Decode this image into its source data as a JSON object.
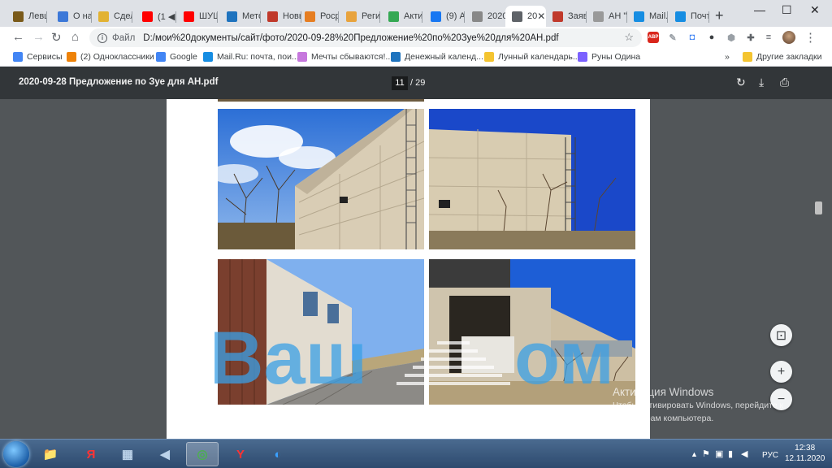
{
  "tabs": [
    {
      "label": "Левш",
      "icon": "book-icon",
      "color": "#7a5a1a"
    },
    {
      "label": "О на",
      "icon": "globe-blue-icon",
      "color": "#3c78d8"
    },
    {
      "label": "Сдел",
      "icon": "b-icon",
      "color": "#e2b233"
    },
    {
      "label": "(1 ◀",
      "icon": "youtube-icon",
      "color": "#ff0000"
    },
    {
      "label": "ШУШ",
      "icon": "youtube-icon",
      "color": "#ff0000"
    },
    {
      "label": "Мето",
      "icon": "metro-icon",
      "color": "#1e73be"
    },
    {
      "label": "Новь",
      "icon": "news-icon",
      "color": "#c0392b"
    },
    {
      "label": "Росре",
      "icon": "rosreestr-icon",
      "color": "#e67e22"
    },
    {
      "label": "Реги",
      "icon": "reg-icon",
      "color": "#e8a33d"
    },
    {
      "label": "Акти",
      "icon": "play-icon",
      "color": "#34a853"
    },
    {
      "label": "(9) А",
      "icon": "facebook-icon",
      "color": "#1877f2"
    },
    {
      "label": "2020",
      "icon": "globe-gray-icon",
      "color": "#888888"
    },
    {
      "label": "20",
      "icon": "globe-icon",
      "color": "#5f6368",
      "active": true
    },
    {
      "label": "Заяв",
      "icon": "flag-icon",
      "color": "#c0392b"
    },
    {
      "label": "АН \"",
      "icon": "triangle-icon",
      "color": "#999999"
    },
    {
      "label": "Mail.",
      "icon": "mail-at-icon",
      "color": "#168de2"
    },
    {
      "label": "Почт",
      "icon": "envelope-icon",
      "color": "#168de2"
    }
  ],
  "new_tab": "+",
  "window_controls": {
    "minimize": "—",
    "maximize": "☐",
    "close": "✕"
  },
  "toolbar": {
    "back": "←",
    "forward": "→",
    "reload": "↻",
    "home": "⌂",
    "scheme": "Файл",
    "url": "D:/мои%20документы/сайт/фото/2020-09-28%20Предложение%20по%20Зуе%20для%20АН.pdf",
    "star": "☆",
    "extensions": [
      {
        "label": "ABP",
        "color": "#d9261c"
      },
      {
        "label": "✎",
        "color": "#9aa0a6"
      },
      {
        "label": "◘",
        "color": "#4285f4"
      },
      {
        "label": "●",
        "color": "#3c4043"
      },
      {
        "label": "⬢",
        "color": "#9aa0a6"
      },
      {
        "label": "✚",
        "color": "#5f6368"
      },
      {
        "label": "≡",
        "color": "#5f6368"
      }
    ],
    "menu": "⋮"
  },
  "bookmarks": [
    {
      "label": "Сервисы",
      "icon": "apps-grid-icon",
      "color": "#4285f4"
    },
    {
      "label": "(2) Одноклассники",
      "icon": "ok-icon",
      "color": "#ee8208"
    },
    {
      "label": "Google",
      "icon": "google-icon",
      "color": "#4285f4"
    },
    {
      "label": "Mail.Ru: почта, пои...",
      "icon": "mail-at-icon",
      "color": "#168de2"
    },
    {
      "label": "Мечты сбываются!...",
      "icon": "flower-icon",
      "color": "#c678dd"
    },
    {
      "label": "Денежный календ...",
      "icon": "globe-icon",
      "color": "#1e73be"
    },
    {
      "label": "Лунный календарь...",
      "icon": "moon-icon",
      "color": "#f4c430"
    },
    {
      "label": "Руны Одина",
      "icon": "rune-icon",
      "color": "#7b61ff"
    }
  ],
  "bookmarks_more": "»",
  "other_bookmarks": "Другие закладки",
  "pdf": {
    "title": "2020-09-28 Предложение по Зуе для АН.pdf",
    "current_page": "11",
    "total_pages": "/ 29",
    "rotate": "↻",
    "download": "⤓",
    "print": "⎙"
  },
  "watermark": "Ваш дом",
  "zoom": {
    "fit": "⊡",
    "in": "+",
    "out": "−"
  },
  "activation": {
    "title": "Активация Windows",
    "line1": "Чтобы активировать Windows, перейдите к",
    "line2": "параметрам компьютера."
  },
  "taskbar": {
    "apps": [
      {
        "name": "explorer",
        "glyph": "📁",
        "color": "#f5c242"
      },
      {
        "name": "yandex-browser",
        "glyph": "Я",
        "color": "#ff3333"
      },
      {
        "name": "calculator",
        "glyph": "▦",
        "color": "#bcd3ea"
      },
      {
        "name": "volume-app",
        "glyph": "◀",
        "color": "#bcd3ea"
      },
      {
        "name": "chrome",
        "glyph": "◎",
        "color": "#4caf50",
        "pressed": true
      },
      {
        "name": "yandex",
        "glyph": "Y",
        "color": "#ff3333"
      },
      {
        "name": "skype-like",
        "glyph": "◐",
        "color": "#3aa0ff"
      }
    ],
    "tray_lang": "РУС",
    "time": "12:38",
    "date": "12.11.2020"
  }
}
